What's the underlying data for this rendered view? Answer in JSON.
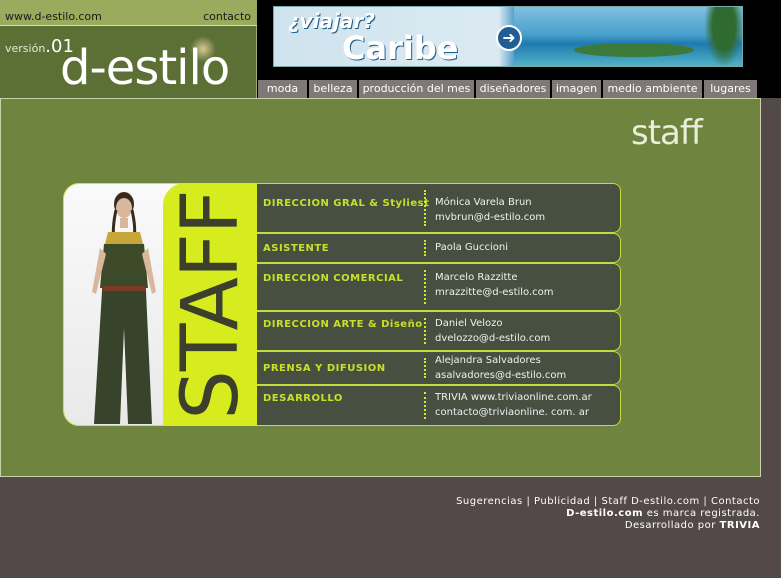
{
  "header": {
    "site_url": "www.d-estilo.com",
    "contacto": "contacto",
    "version_label": "versión",
    "version_num": ".01",
    "brand": "d-estilo"
  },
  "banner": {
    "question": "¿viajar?",
    "destination": "Caribe",
    "arrow_icon": "arrow-right-icon"
  },
  "nav": {
    "tabs": [
      "moda",
      "belleza",
      "producción del mes",
      "diseñadores",
      "imagen",
      "medio ambiente",
      "lugares"
    ]
  },
  "page": {
    "title": "staff",
    "vertical_label": "STAFF"
  },
  "staff": [
    {
      "role": "DIRECCION GRAL & Styliest",
      "name": "Mónica Varela Brun",
      "email": "mvbrun@d-estilo.com"
    },
    {
      "role": "ASISTENTE",
      "name": "Paola Guccioni",
      "email": ""
    },
    {
      "role": "DIRECCION COMERCIAL",
      "name": "Marcelo Razzitte",
      "email": "mrazzitte@d-estilo.com"
    },
    {
      "role": "DIRECCION ARTE & Diseño",
      "name": "Daniel Velozo",
      "email": "dvelozzo@d-estilo.com"
    },
    {
      "role": "PRENSA Y DIFUSION",
      "name": "Alejandra Salvadores",
      "email": "asalvadores@d-estilo.com"
    },
    {
      "role": "DESARROLLO",
      "name": "TRIVIA  www.triviaonline.com.ar",
      "email": "contacto@triviaonline. com. ar"
    }
  ],
  "footer": {
    "links": [
      "Sugerencias",
      "Publicidad",
      "Staff D-estilo.com",
      "Contacto"
    ],
    "separator": "|",
    "brand": "D-estilo.com",
    "trademark": "es marca registrada.",
    "developed_by": "Desarrollado por",
    "developer": "TRIVIA"
  },
  "colors": {
    "content_bg": "#6f843f",
    "accent": "#d6ec1e",
    "row_bg": "#464f40",
    "footer_bg": "#524948"
  }
}
